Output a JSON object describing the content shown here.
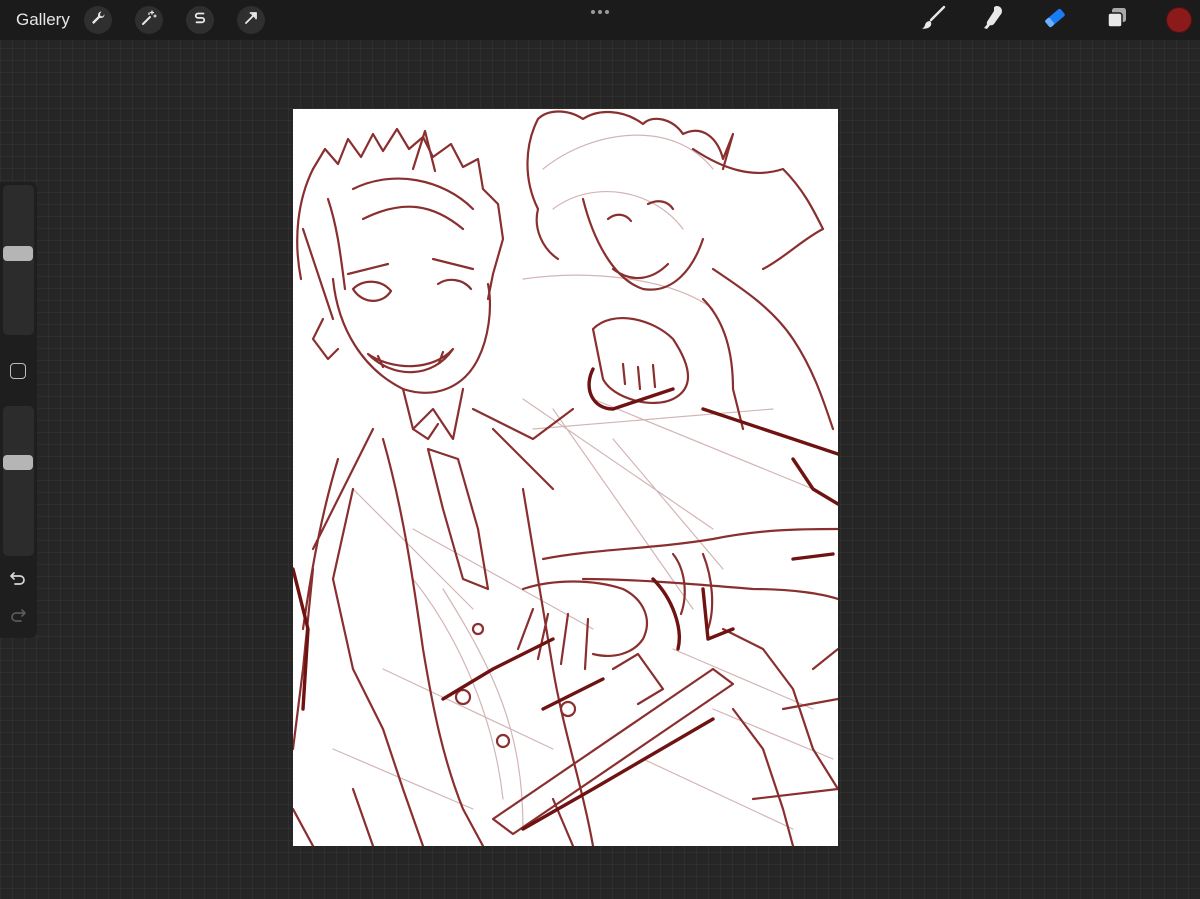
{
  "topbar": {
    "gallery_label": "Gallery",
    "left_tools": [
      {
        "name": "actions",
        "icon": "wrench-icon"
      },
      {
        "name": "adjustments",
        "icon": "magic-wand-icon"
      },
      {
        "name": "selection",
        "icon": "selection-s-icon"
      },
      {
        "name": "transform",
        "icon": "arrow-cursor-icon"
      }
    ],
    "center_menu_icon": "more-dots-icon",
    "right_tools": [
      {
        "name": "brush",
        "icon": "brush-icon",
        "active": false
      },
      {
        "name": "smudge",
        "icon": "smudge-icon",
        "active": false
      },
      {
        "name": "eraser",
        "icon": "eraser-icon",
        "active": true
      },
      {
        "name": "layers",
        "icon": "layers-icon",
        "active": false
      }
    ],
    "current_color": "#8b1a1a",
    "active_tool_color": "#1a7cf5"
  },
  "sidebar": {
    "brush_size_slider": {
      "icon": "brush-size-slider",
      "value": 0.55
    },
    "modify_button_icon": "square-modify-icon",
    "opacity_slider": {
      "icon": "opacity-slider",
      "value": 0.64
    },
    "undo_icon": "undo-icon",
    "redo_icon": "redo-icon"
  },
  "canvas": {
    "background": "#ffffff",
    "stroke_color": "#7a1f1f",
    "sketch_color": "#b07b7b"
  }
}
